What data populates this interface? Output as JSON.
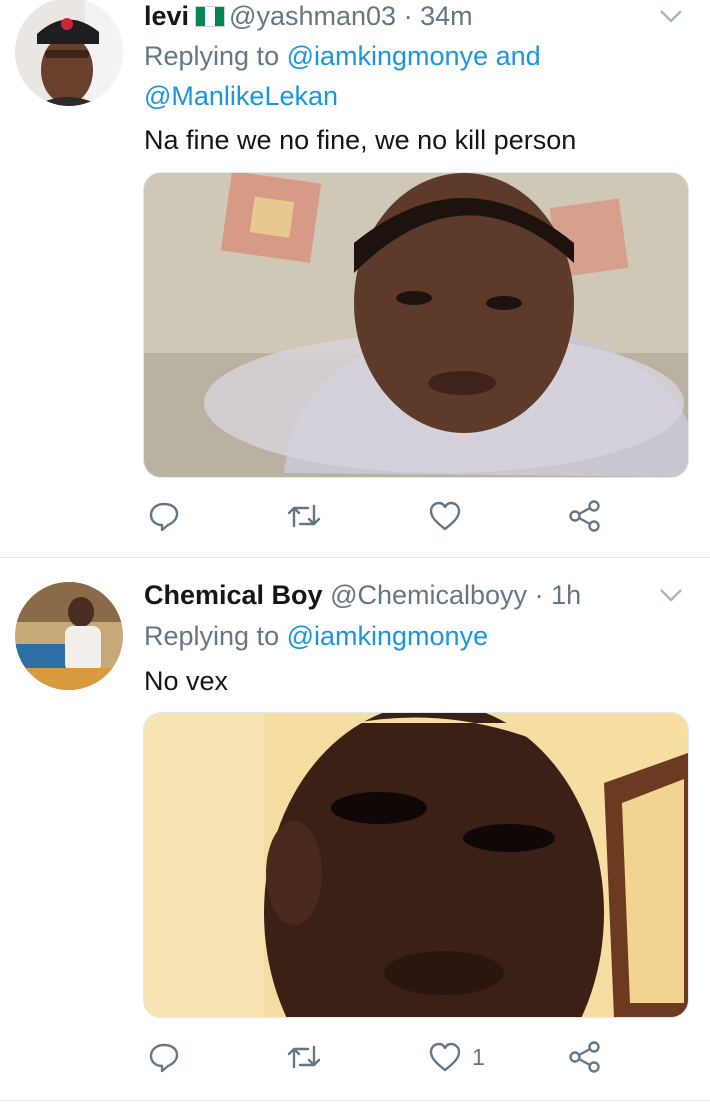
{
  "tweets": [
    {
      "name": "levi",
      "flag_icon": "nigeria-flag-icon",
      "handle": "@yashman03",
      "separator": "·",
      "time": "34m",
      "replying_label": "Replying to",
      "mention_1": "@iamkingmonye",
      "and_label": "and",
      "mention_2": "@ManlikeLekan",
      "text": "Na fine we no fine, we no kill person",
      "likes": ""
    },
    {
      "name": "Chemical Boy",
      "handle": "@Chemicalboyy",
      "separator": "·",
      "time": "1h",
      "replying_label": "Replying to",
      "mention_1": "@iamkingmonye",
      "text": "No vex",
      "likes": "1"
    }
  ],
  "icons": [
    "reply-icon",
    "retweet-icon",
    "like-icon",
    "share-icon",
    "chevron-down-icon"
  ],
  "colors": {
    "link": "#1b95e0",
    "secondary": "#657786",
    "divider": "#e1e8ed"
  }
}
